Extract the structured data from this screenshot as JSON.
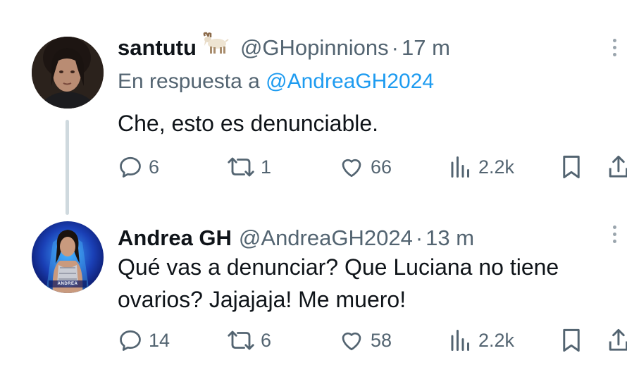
{
  "tweets": [
    {
      "display_name": "santutu",
      "name_emoji": "goat-emoji",
      "handle": "@GHopinnions",
      "separator": "·",
      "time": "17 m",
      "reply_prefix": "En respuesta a",
      "reply_to": "@AndreaGH2024",
      "text": "Che, esto es denunciable.",
      "replies": "6",
      "retweets": "1",
      "likes": "66",
      "views": "2.2k"
    },
    {
      "display_name": "Andrea GH",
      "handle": "@AndreaGH2024",
      "separator": "·",
      "time": "13 m",
      "avatar_label": "ANDREA",
      "text": "Qué vas a denunciar? Que Luciana no tiene ovarios? Jajajaja! Me muero!",
      "replies": "14",
      "retweets": "6",
      "likes": "58",
      "views": "2.2k"
    }
  ],
  "colors": {
    "text_primary": "#0f1419",
    "text_secondary": "#536471",
    "link": "#1d9bf0",
    "thread_line": "#cfd9de"
  },
  "icons": [
    "reply-icon",
    "retweet-icon",
    "like-icon",
    "views-icon",
    "bookmark-icon",
    "share-icon",
    "more-icon"
  ]
}
